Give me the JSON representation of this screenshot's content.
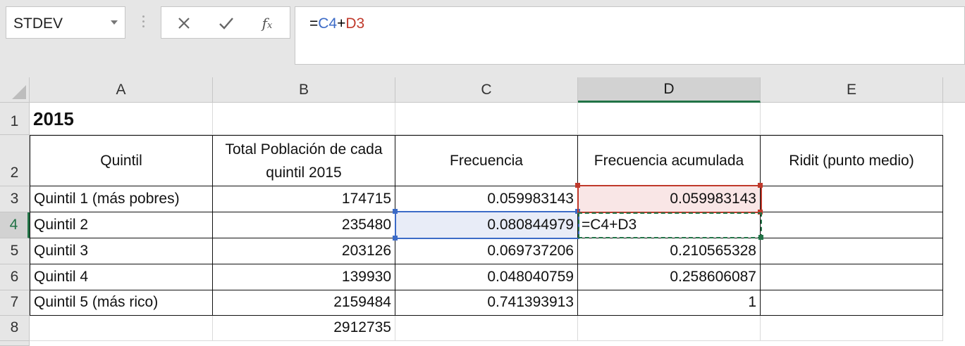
{
  "name_box": {
    "value": "STDEV"
  },
  "formula_bar": {
    "prefix": "=",
    "ref1": "C4",
    "op": "+",
    "ref2": "D3"
  },
  "columns": [
    "A",
    "B",
    "C",
    "D",
    "E"
  ],
  "rows": [
    "1",
    "2",
    "3",
    "4",
    "5",
    "6",
    "7",
    "8"
  ],
  "cells": {
    "A1": "2015",
    "A2": "Quintil",
    "B2": "Total Población de cada quintil 2015",
    "C2": "Frecuencia",
    "D2": "Frecuencia acumulada",
    "E2": "Ridit (punto medio)",
    "A3": "Quintil 1 (más pobres)",
    "B3": "174715",
    "C3": "0.059983143",
    "D3": "0.059983143",
    "A4": "Quintil 2",
    "B4": "235480",
    "C4": "0.080844979",
    "D4": "=C4+D3",
    "A5": "Quintil 3",
    "B5": "203126",
    "C5": "0.069737206",
    "D5": "0.210565328",
    "A6": "Quintil 4",
    "B6": "139930",
    "C6": "0.048040759",
    "D6": "0.258606087",
    "A7": "Quintil 5 (más rico)",
    "B7": "2159484",
    "C7": "0.741393913",
    "D7": "1",
    "B8": "2912735"
  },
  "colors": {
    "ref_blue": "#3c6bc7",
    "ref_red": "#c0392b",
    "active_green": "#217346"
  }
}
